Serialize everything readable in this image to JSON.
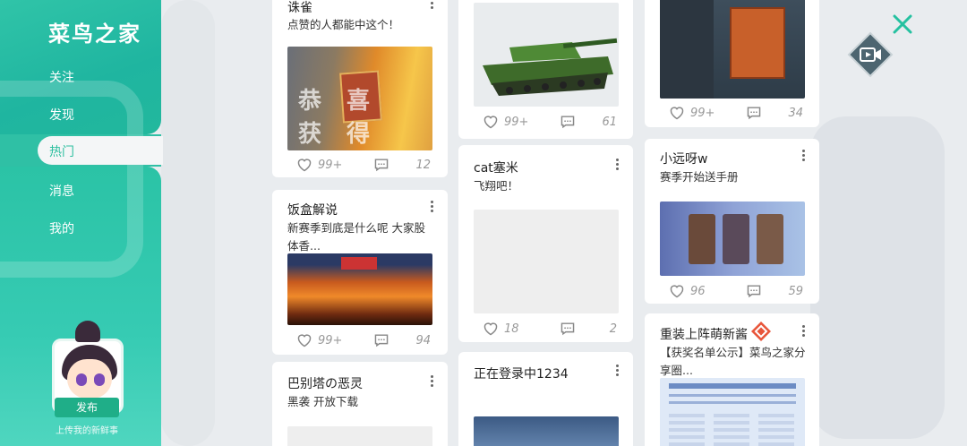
{
  "app": {
    "title": "菜鸟之家"
  },
  "nav": {
    "items": [
      "关注",
      "发现",
      "热门",
      "消息",
      "我的"
    ],
    "active": "热门"
  },
  "publish": {
    "button_label": "发布",
    "hint": "上传我的新鲜事"
  },
  "cards": {
    "c1": {
      "title": "诛雀",
      "desc": "点赞的人都能中这个！",
      "likes": "99+",
      "comments": "12",
      "banner_text": "恭喜获得"
    },
    "c2": {
      "title": "饭盒解说",
      "desc": "新赛季到底是什么呢 大家股体香...",
      "likes": "99+",
      "comments": "94"
    },
    "c3": {
      "title": "巴别塔の恶灵",
      "desc": "黑袭 开放下载"
    },
    "c4": {
      "likes": "99+",
      "comments": "61"
    },
    "c5": {
      "title": "cat塞米",
      "desc": "飞翔吧！",
      "likes": "18",
      "comments": "2"
    },
    "c6": {
      "title": "正在登录中1234"
    },
    "c7": {
      "likes": "99+",
      "comments": "34"
    },
    "c8": {
      "title": "小远呀w",
      "desc": "赛季开始送手册",
      "likes": "96",
      "comments": "59"
    },
    "c9": {
      "title": "重装上阵萌新酱",
      "desc": "【获奖名单公示】菜鸟之家分享圈..."
    }
  },
  "icons": {
    "like": "heart-outline-icon",
    "comment": "comment-icon",
    "more": "more-vertical-icon",
    "close": "close-icon",
    "video": "video-camera-icon"
  },
  "colors": {
    "accent": "#2cbf9f",
    "close": "#25c1a0",
    "video_bg": "#4d6570"
  }
}
